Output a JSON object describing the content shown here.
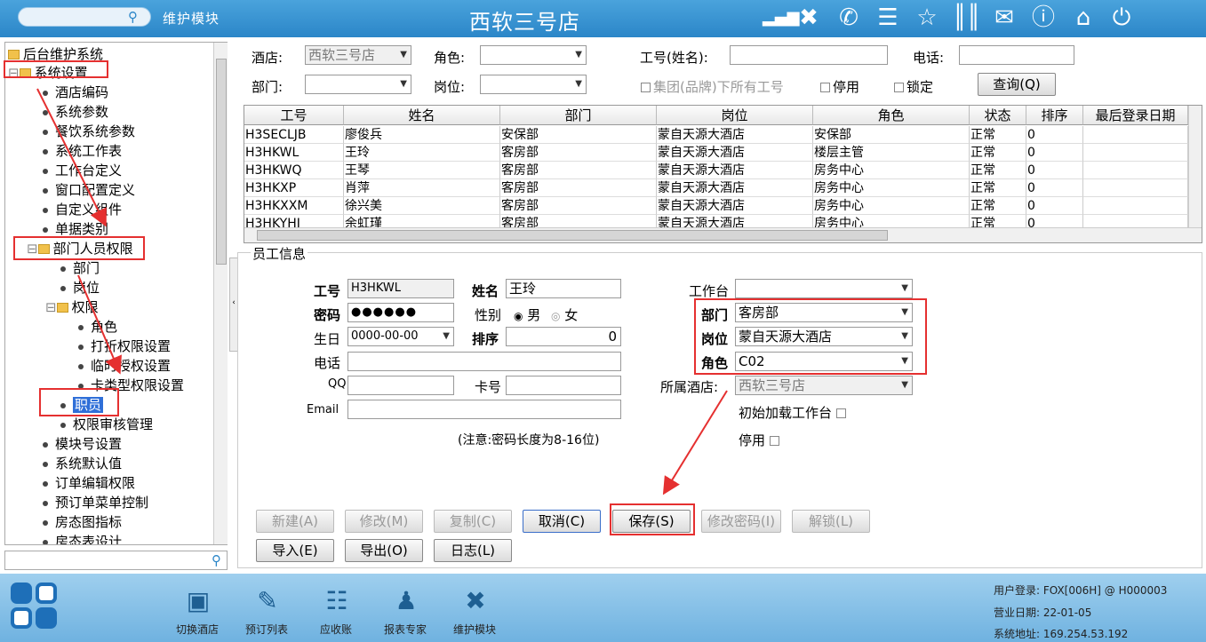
{
  "topbar": {
    "module_label": "维护模块",
    "title": "西软三号店",
    "icons": [
      "signal-icon",
      "tools-icon",
      "phone-icon",
      "menu-icon",
      "star-icon",
      "columns-icon",
      "mail-icon",
      "help-icon",
      "home-icon",
      "power-icon"
    ]
  },
  "tree": {
    "items": [
      {
        "label": "后台维护系统",
        "type": "folder"
      },
      {
        "label": "系统设置",
        "type": "folder"
      },
      {
        "label": "酒店编码",
        "type": "leaf"
      },
      {
        "label": "系统参数",
        "type": "leaf"
      },
      {
        "label": "餐饮系统参数",
        "type": "leaf"
      },
      {
        "label": "系统工作表",
        "type": "leaf"
      },
      {
        "label": "工作台定义",
        "type": "leaf"
      },
      {
        "label": "窗口配置定义",
        "type": "leaf"
      },
      {
        "label": "自定义组件",
        "type": "leaf"
      },
      {
        "label": "单据类别",
        "type": "leaf"
      },
      {
        "label": "部门人员权限",
        "type": "folder"
      },
      {
        "label": "部门",
        "type": "leaf"
      },
      {
        "label": "岗位",
        "type": "leaf"
      },
      {
        "label": "权限",
        "type": "folder"
      },
      {
        "label": "角色",
        "type": "leaf"
      },
      {
        "label": "打折权限设置",
        "type": "leaf"
      },
      {
        "label": "临时授权设置",
        "type": "leaf"
      },
      {
        "label": "卡类型权限设置",
        "type": "leaf"
      },
      {
        "label": "职员",
        "type": "leaf"
      },
      {
        "label": "权限审核管理",
        "type": "leaf"
      },
      {
        "label": "模块号设置",
        "type": "leaf"
      },
      {
        "label": "系统默认值",
        "type": "leaf"
      },
      {
        "label": "订单编辑权限",
        "type": "leaf"
      },
      {
        "label": "预订单菜单控制",
        "type": "leaf"
      },
      {
        "label": "房态图指标",
        "type": "leaf"
      },
      {
        "label": "房态表设计",
        "type": "leaf"
      }
    ]
  },
  "filter": {
    "hotel_label": "酒店:",
    "hotel_value": "西软三号店",
    "role_label": "角色:",
    "role_value": "",
    "empno_label": "工号(姓名):",
    "empno_value": "",
    "phone_label": "电话:",
    "phone_value": "",
    "dept_label": "部门:",
    "dept_value": "",
    "post_label": "岗位:",
    "post_value": "",
    "group_label": "集团(品牌)下所有工号",
    "disabled_label": "停用",
    "locked_label": "锁定",
    "query_button": "查询(Q)"
  },
  "grid": {
    "columns": [
      "工号",
      "姓名",
      "部门",
      "岗位",
      "角色",
      "状态",
      "排序",
      "最后登录日期"
    ],
    "rows": [
      [
        "H3SECLJB",
        "廖俊兵",
        "安保部",
        "蒙自天源大酒店",
        "安保部",
        "正常",
        "0",
        ""
      ],
      [
        "H3HKWL",
        "王玲",
        "客房部",
        "蒙自天源大酒店",
        "楼层主管",
        "正常",
        "0",
        ""
      ],
      [
        "H3HKWQ",
        "王琴",
        "客房部",
        "蒙自天源大酒店",
        "房务中心",
        "正常",
        "0",
        ""
      ],
      [
        "H3HKXP",
        "肖萍",
        "客房部",
        "蒙自天源大酒店",
        "房务中心",
        "正常",
        "0",
        ""
      ],
      [
        "H3HKXXM",
        "徐兴美",
        "客房部",
        "蒙自天源大酒店",
        "房务中心",
        "正常",
        "0",
        ""
      ],
      [
        "H3HKYHJ",
        "余虹瑾",
        "客房部",
        "蒙自天源大酒店",
        "房务中心",
        "正常",
        "0",
        ""
      ]
    ]
  },
  "employee": {
    "section_title": "员工信息",
    "empno_label": "工号",
    "empno_value": "H3HKWL",
    "name_label": "姓名",
    "name_value": "王玲",
    "password_label": "密码",
    "password_value": "●●●●●●",
    "gender_label": "性别",
    "male": "男",
    "female": "女",
    "birthday_label": "生日",
    "birthday_value": "0000-00-00",
    "sort_label": "排序",
    "sort_value": "0",
    "phone_label": "电话",
    "phone_value": "",
    "qq_label": "QQ",
    "qq_value": "",
    "card_label": "卡号",
    "card_value": "",
    "email_label": "Email",
    "email_value": "",
    "note": "(注意:密码长度为8-16位)",
    "workbench_label": "工作台",
    "workbench_value": "",
    "dept_label": "部门",
    "dept_value": "客房部",
    "post_label": "岗位",
    "post_value": "蒙自天源大酒店",
    "role_label": "角色",
    "role_value": "C02",
    "hotel_label": "所属酒店:",
    "hotel_value": "西软三号店",
    "init_workbench_label": "初始加载工作台",
    "disabled_label": "停用"
  },
  "actions": {
    "new": "新建(A)",
    "edit": "修改(M)",
    "copy": "复制(C)",
    "cancel": "取消(C)",
    "save": "保存(S)",
    "change_password": "修改密码(I)",
    "unlock": "解锁(L)",
    "import": "导入(E)",
    "export": "导出(O)",
    "log": "日志(L)"
  },
  "bottom": {
    "nav": [
      {
        "label": "切换酒店",
        "icon": "switch-hotel-icon"
      },
      {
        "label": "预订列表",
        "icon": "reservation-list-icon"
      },
      {
        "label": "应收账",
        "icon": "receivable-icon"
      },
      {
        "label": "报表专家",
        "icon": "report-expert-icon"
      },
      {
        "label": "维护模块",
        "icon": "maintenance-icon"
      }
    ],
    "user_login": "用户登录: FOX[006H] @ H000003",
    "business_date": "营业日期: 22-01-05",
    "system_address": "系统地址: 169.254.53.192"
  }
}
